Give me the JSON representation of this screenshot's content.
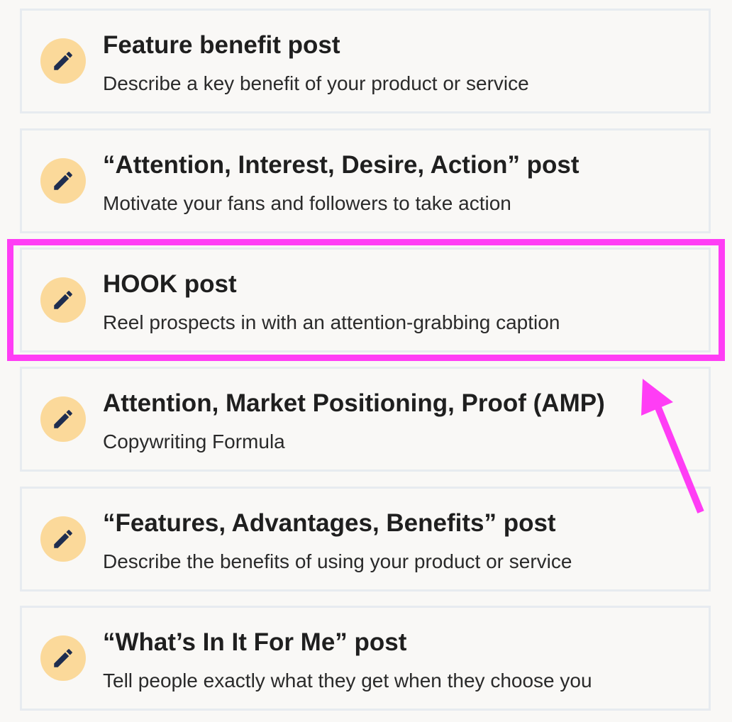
{
  "templates": [
    {
      "title": "Feature benefit post",
      "description": "Describe a key benefit of your product or service",
      "icon": "pencil-icon"
    },
    {
      "title": "“Attention, Interest, Desire, Action” post",
      "description": "Motivate your fans and followers to take action",
      "icon": "pencil-icon"
    },
    {
      "title": "HOOK post",
      "description": "Reel prospects in with an attention-grabbing caption",
      "icon": "pencil-icon"
    },
    {
      "title": "Attention, Market Positioning, Proof (AMP)",
      "description": "Copywriting Formula",
      "icon": "pencil-icon"
    },
    {
      "title": "“Features, Advantages, Benefits” post",
      "description": "Describe the benefits of using your product or service",
      "icon": "pencil-icon"
    },
    {
      "title": "“What’s In It For Me” post",
      "description": "Tell people exactly what they get when they choose you",
      "icon": "pencil-icon"
    }
  ],
  "annotation": {
    "highlighted_item": "HOOK post",
    "color": "#ff3df5"
  },
  "colors": {
    "icon_background": "#fbd99a",
    "icon_glyph": "#1e2d4f",
    "card_border": "#e7ebf0",
    "page_background": "#f9f8f6"
  }
}
